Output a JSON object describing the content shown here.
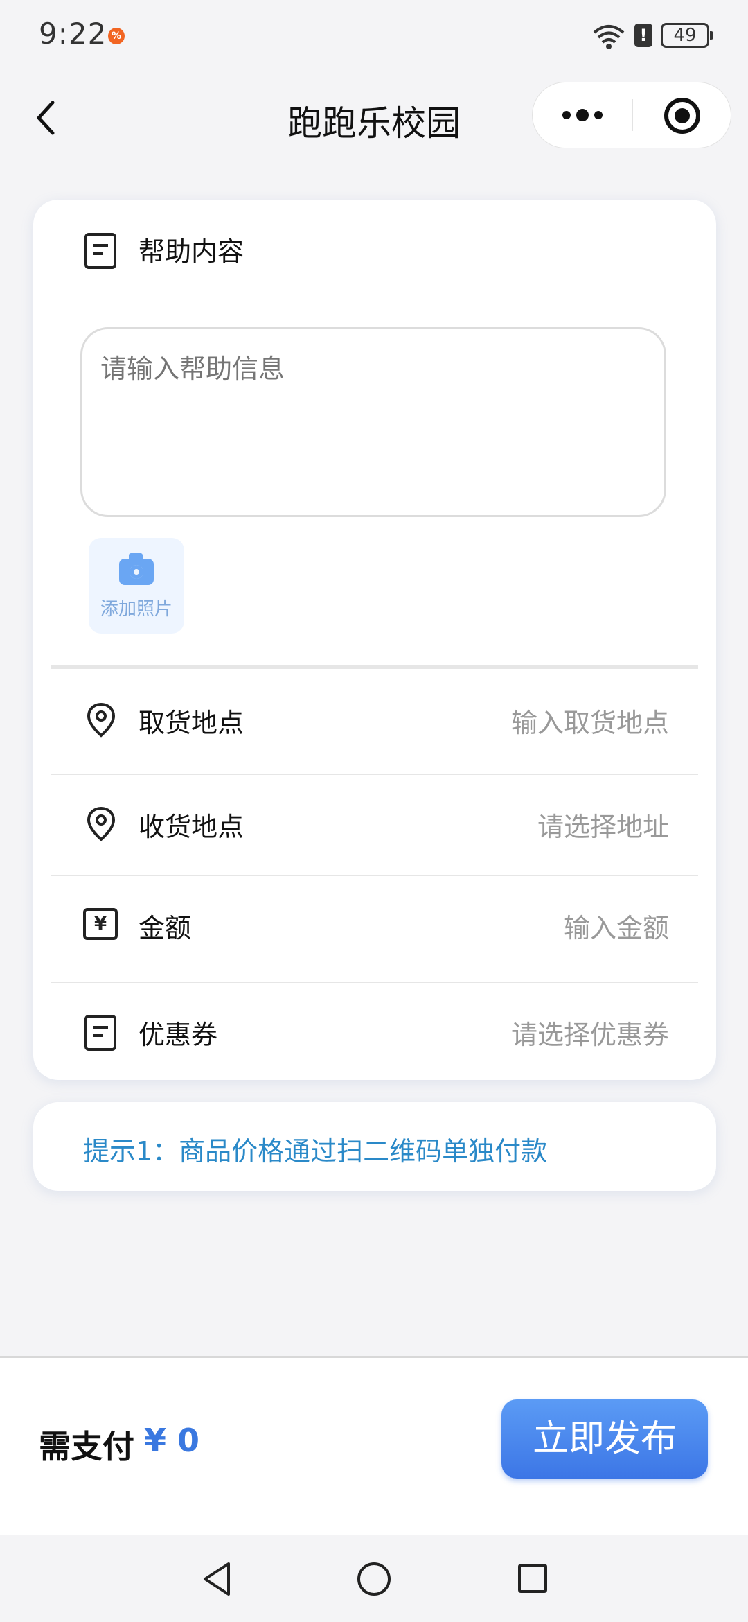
{
  "status_bar": {
    "time": "9:22",
    "notification_badge": "%",
    "alert": "!",
    "battery": "49"
  },
  "nav": {
    "title": "跑跑乐校园"
  },
  "help": {
    "label": "帮助内容",
    "placeholder": "请输入帮助信息",
    "add_photo": "添加照片"
  },
  "rows": [
    {
      "label": "取货地点",
      "value": "输入取货地点",
      "icon": "location-pin-icon"
    },
    {
      "label": "收货地点",
      "value": "请选择地址",
      "icon": "location-pin-icon"
    },
    {
      "label": "金额",
      "value": "输入金额",
      "icon": "yen-icon"
    },
    {
      "label": "优惠券",
      "value": "请选择优惠券",
      "icon": "document-icon"
    }
  ],
  "yen_symbol": "¥",
  "tip": {
    "text": "提示1：商品价格通过扫二维码单独付款"
  },
  "bottom": {
    "pay_label": "需支付",
    "pay_amount": "¥ 0",
    "publish_label": "立即发布"
  },
  "colors": {
    "accent": "#3c76e6",
    "tip": "#2a89c8",
    "placeholder": "#999999"
  }
}
